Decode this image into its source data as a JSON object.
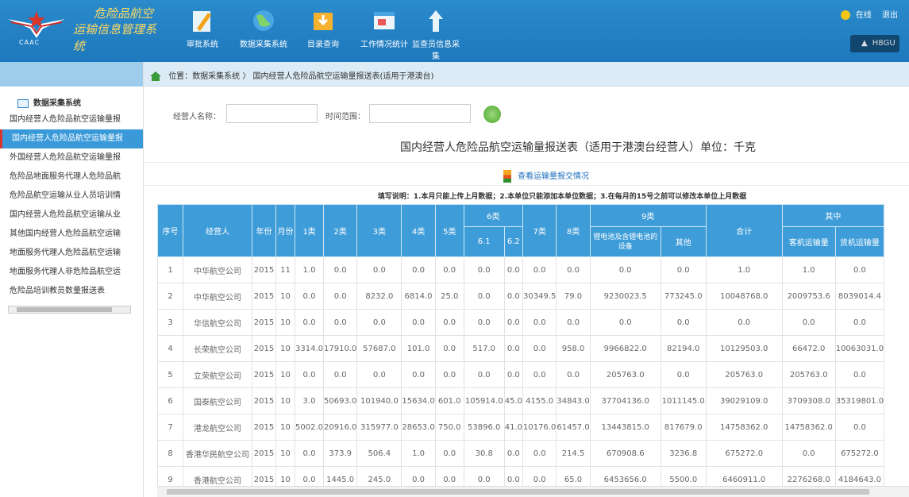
{
  "header": {
    "brand_line1": "危险品航空",
    "brand_line2": "运输信息管理系统",
    "caac": "CAAC",
    "nav": [
      {
        "label": "审批系统",
        "icon": "edit-icon"
      },
      {
        "label": "数据采集系统",
        "icon": "globe-icon"
      },
      {
        "label": "目录查询",
        "icon": "folder-download-icon"
      },
      {
        "label": "工作情况统计",
        "icon": "window-chart-icon"
      },
      {
        "label": "监查员信息采集",
        "icon": "tower-icon"
      }
    ],
    "status_online": "在线",
    "logout": "退出",
    "user": "H8GU"
  },
  "sidebar": {
    "title": "数据采集系统",
    "items": [
      "国内经营人危险品航空运输量报",
      "国内经营人危险品航空运输量报",
      "外国经营人危险品航空运输量报",
      "危险品地面服务代理人危险品航",
      "危险品航空运输从业人员培训情",
      "国内经营人危险品航空运输从业",
      "其他国内经营人危险品航空运输",
      "地面服务代理人危险品航空运输",
      "地面服务代理人非危险品航空运",
      "危险品培训教员数量报送表"
    ],
    "active_index": 1
  },
  "breadcrumb": {
    "prefix": "位置：",
    "path": "数据采集系统 〉 国内经营人危险品航空运输量报送表(适用于港澳台)"
  },
  "search": {
    "operator_label": "经营人名称：",
    "time_label": "时间范围："
  },
  "report": {
    "title": "国内经营人危险品航空运输量报送表（适用于港澳台经营人）单位：千克",
    "link": "查看运输量报交情况",
    "note": "填写说明：1.本月只能上传上月数据；2.本单位只能添加本单位数据；3.在每月的15号之前可以修改本单位上月数据"
  },
  "table": {
    "h": {
      "seq": "序号",
      "operator": "经营人",
      "year": "年份",
      "month": "月份",
      "c1": "1类",
      "c2": "2类",
      "c3": "3类",
      "c4": "4类",
      "c5": "5类",
      "c6": "6类",
      "c6_1": "6.1",
      "c6_2": "6.2",
      "c7": "7类",
      "c8": "8类",
      "c9": "9类",
      "c9_a": "锂电池及含锂电池的设备",
      "c9_b": "其他",
      "total": "合计",
      "of_which": "其中",
      "passenger": "客机运输量",
      "cargo": "货机运输量"
    },
    "rows": [
      [
        "1",
        "中华航空公司",
        "2015",
        "11",
        "1.0",
        "0.0",
        "0.0",
        "0.0",
        "0.0",
        "0.0",
        "0.0",
        "0.0",
        "0.0",
        "0.0",
        "0.0",
        "1.0",
        "1.0",
        "0.0"
      ],
      [
        "2",
        "中华航空公司",
        "2015",
        "10",
        "0.0",
        "0.0",
        "8232.0",
        "6814.0",
        "25.0",
        "0.0",
        "0.0",
        "30349.5",
        "79.0",
        "9230023.5",
        "773245.0",
        "10048768.0",
        "2009753.6",
        "8039014.4"
      ],
      [
        "3",
        "华信航空公司",
        "2015",
        "10",
        "0.0",
        "0.0",
        "0.0",
        "0.0",
        "0.0",
        "0.0",
        "0.0",
        "0.0",
        "0.0",
        "0.0",
        "0.0",
        "0.0",
        "0.0",
        "0.0"
      ],
      [
        "4",
        "长荣航空公司",
        "2015",
        "10",
        "3314.0",
        "17910.0",
        "57687.0",
        "101.0",
        "0.0",
        "517.0",
        "0.0",
        "0.0",
        "958.0",
        "9966822.0",
        "82194.0",
        "10129503.0",
        "66472.0",
        "10063031.0"
      ],
      [
        "5",
        "立荣航空公司",
        "2015",
        "10",
        "0.0",
        "0.0",
        "0.0",
        "0.0",
        "0.0",
        "0.0",
        "0.0",
        "0.0",
        "0.0",
        "205763.0",
        "0.0",
        "205763.0",
        "205763.0",
        "0.0"
      ],
      [
        "6",
        "国泰航空公司",
        "2015",
        "10",
        "3.0",
        "50693.0",
        "101940.0",
        "15634.0",
        "601.0",
        "105914.0",
        "45.0",
        "4155.0",
        "34843.0",
        "37704136.0",
        "1011145.0",
        "39029109.0",
        "3709308.0",
        "35319801.0"
      ],
      [
        "7",
        "港龙航空公司",
        "2015",
        "10",
        "5002.0",
        "20916.0",
        "315977.0",
        "28653.0",
        "750.0",
        "53896.0",
        "41.0",
        "10176.0",
        "61457.0",
        "13443815.0",
        "817679.0",
        "14758362.0",
        "14758362.0",
        "0.0"
      ],
      [
        "8",
        "香港华民航空公司",
        "2015",
        "10",
        "0.0",
        "373.9",
        "506.4",
        "1.0",
        "0.0",
        "30.8",
        "0.0",
        "0.0",
        "214.5",
        "670908.6",
        "3236.8",
        "675272.0",
        "0.0",
        "675272.0"
      ],
      [
        "9",
        "香港航空公司",
        "2015",
        "10",
        "0.0",
        "1445.0",
        "245.0",
        "0.0",
        "0.0",
        "0.0",
        "0.0",
        "0.0",
        "65.0",
        "6453656.0",
        "5500.0",
        "6460911.0",
        "2276268.0",
        "4184643.0"
      ]
    ]
  }
}
